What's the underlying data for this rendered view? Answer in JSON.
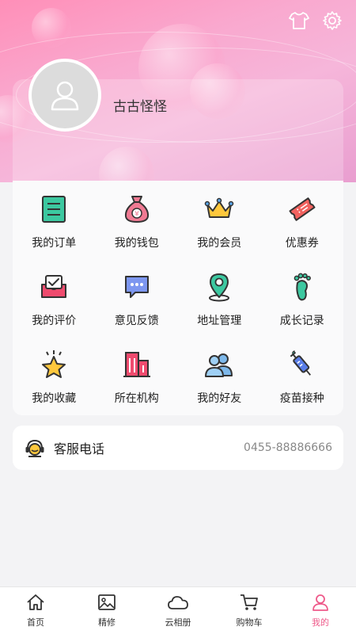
{
  "header": {
    "username": "古古怪怪",
    "icons": [
      "shirt-icon",
      "gear-icon"
    ]
  },
  "grid": {
    "items": [
      {
        "label": "我的订单",
        "icon": "order-list-icon"
      },
      {
        "label": "我的钱包",
        "icon": "money-bag-icon"
      },
      {
        "label": "我的会员",
        "icon": "crown-icon"
      },
      {
        "label": "优惠券",
        "icon": "coupon-icon"
      },
      {
        "label": "我的评价",
        "icon": "review-inbox-icon"
      },
      {
        "label": "意见反馈",
        "icon": "chat-bubble-icon"
      },
      {
        "label": "地址管理",
        "icon": "location-pin-icon"
      },
      {
        "label": "成长记录",
        "icon": "footprint-icon"
      },
      {
        "label": "我的收藏",
        "icon": "star-icon"
      },
      {
        "label": "所在机构",
        "icon": "building-icon"
      },
      {
        "label": "我的好友",
        "icon": "friends-icon"
      },
      {
        "label": "疫苗接种",
        "icon": "vaccine-syringe-icon"
      }
    ]
  },
  "service": {
    "title": "客服电话",
    "phone": "0455-88886666",
    "icon": "headset-icon"
  },
  "bottom_nav": {
    "items": [
      {
        "label": "首页",
        "icon": "home-icon"
      },
      {
        "label": "精修",
        "icon": "image-icon"
      },
      {
        "label": "云相册",
        "icon": "cloud-icon"
      },
      {
        "label": "购物车",
        "icon": "cart-icon"
      },
      {
        "label": "我的",
        "icon": "user-icon"
      }
    ],
    "active_index": 4
  },
  "colors": {
    "accent": "#ee5a8a",
    "header_pink": "#f6b6da",
    "page_bg": "#f3f3f5"
  }
}
